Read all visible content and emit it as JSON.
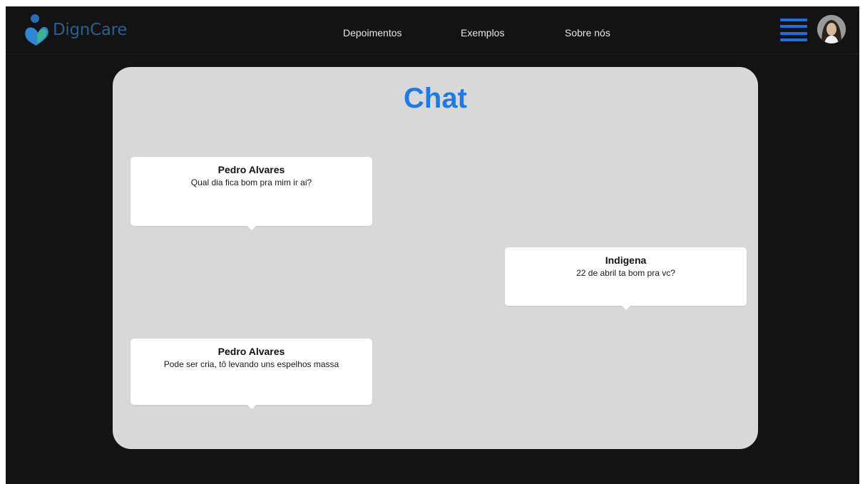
{
  "brand": {
    "name": "DignCare",
    "color": "#2a5f8f",
    "icon": "heart-figure-logo"
  },
  "nav": {
    "items": [
      {
        "label": "Depoimentos"
      },
      {
        "label": "Exemplos"
      },
      {
        "label": "Sobre nós"
      }
    ]
  },
  "header": {
    "menu_icon": "hamburger-menu-icon",
    "avatar_icon": "user-avatar"
  },
  "chat": {
    "title": "Chat",
    "messages": [
      {
        "sender": "Pedro Alvares",
        "text": "Qual dia fica bom pra mim ir ai?"
      },
      {
        "sender": "Indigena",
        "text": "22 de abril ta bom pra vc?"
      },
      {
        "sender": "Pedro Alvares",
        "text": "Pode ser cria, tô levando uns espelhos massa"
      }
    ]
  },
  "colors": {
    "background": "#131313",
    "panel": "#d8d8d8",
    "accent": "#1f7ae6",
    "menu": "#1f6fe0",
    "bubble": "#ffffff"
  }
}
